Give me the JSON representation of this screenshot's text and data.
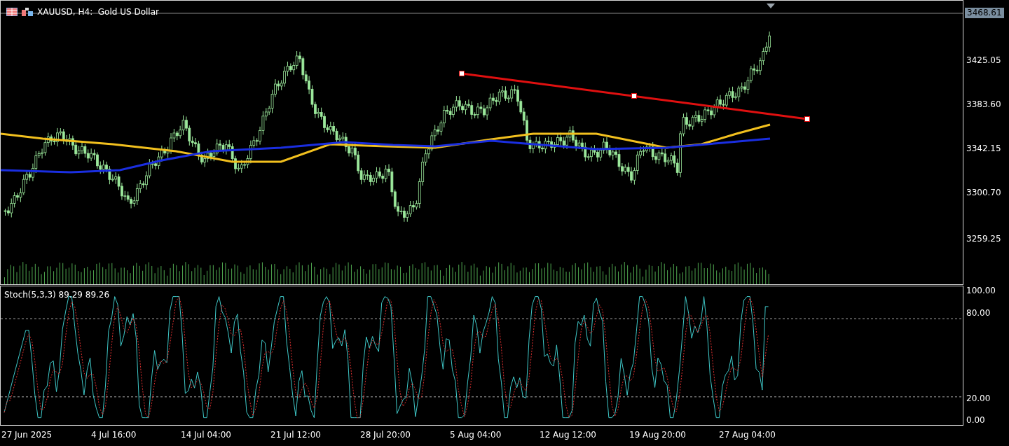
{
  "chart": {
    "title": "XAUUSD, H4:  Gold US Dollar",
    "price_axis": {
      "current_price": "3468.61",
      "labels": [
        "3425.05",
        "3383.60",
        "3342.15",
        "3300.70",
        "3259.25"
      ]
    },
    "stochastic": {
      "label": "Stoch(5,3,3) 89.29 89.26",
      "axis_labels": [
        "100.00",
        "80.00",
        "20.00",
        "0.00"
      ]
    },
    "time_axis": {
      "labels": [
        "27 Jun 2025",
        "4 Jul 16:00",
        "14 Jul 04:00",
        "21 Jul 12:00",
        "28 Jul 20:00",
        "5 Aug 04:00",
        "12 Aug 12:00",
        "19 Aug 20:00",
        "27 Aug 04:00"
      ]
    }
  }
}
